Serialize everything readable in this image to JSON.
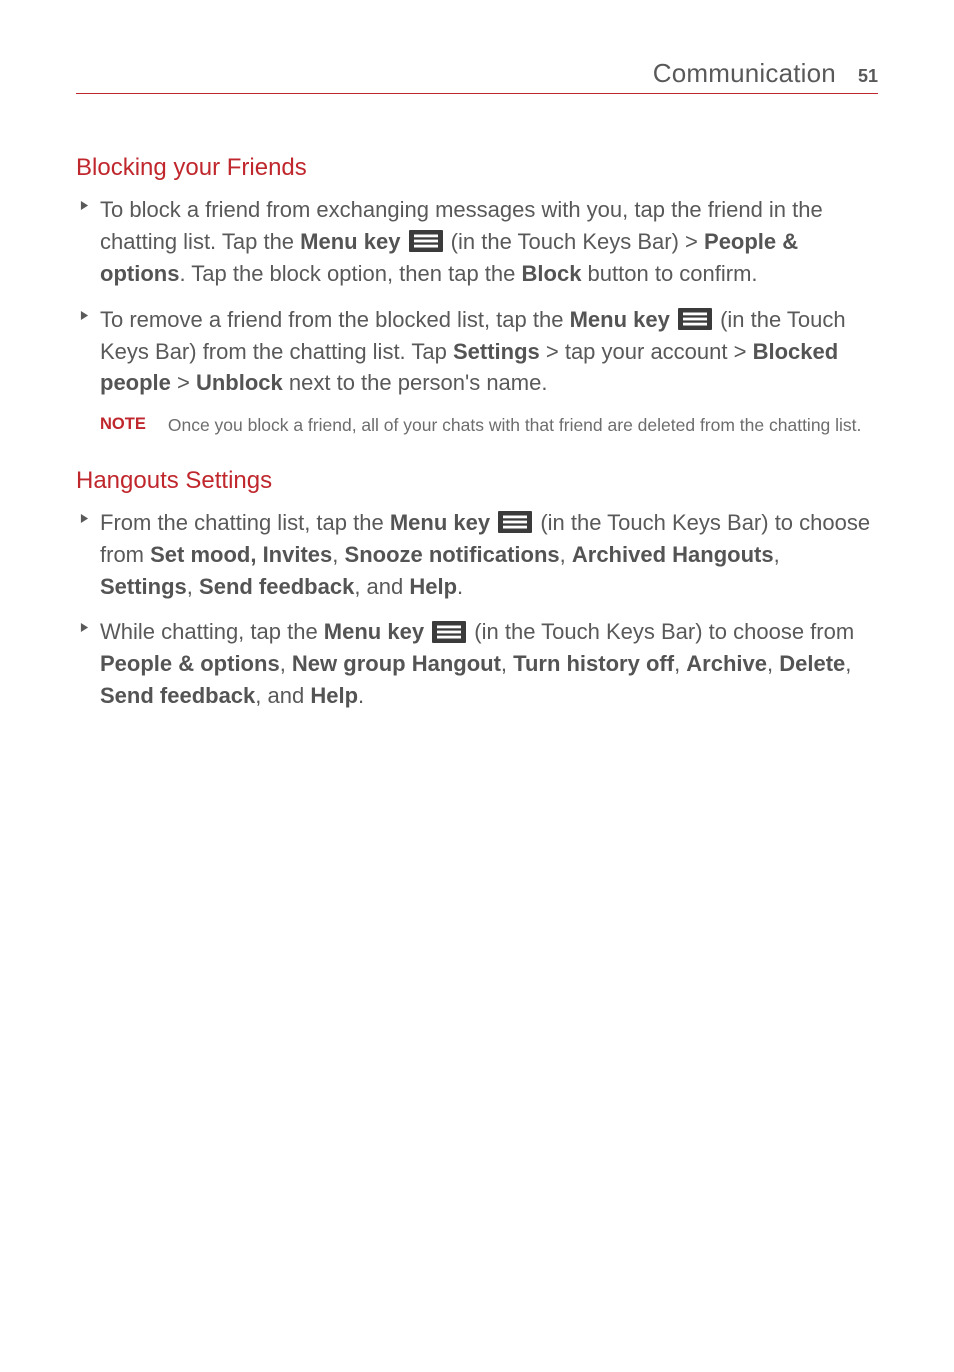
{
  "header": {
    "section": "Communication",
    "page_number": "51"
  },
  "section_a": {
    "heading": "Blocking your Friends",
    "bullet1": {
      "t1": "To block a friend from exchanging messages with you, tap the friend in the chatting list. Tap the ",
      "b1": "Menu key",
      "t2": " ",
      "menu_icon_name": "menu-key-icon",
      "t3": " (in the Touch Keys Bar) > ",
      "b2": "People & options",
      "t4": ". Tap the block option, then tap the ",
      "b3": "Block",
      "t5": " button to confirm."
    },
    "bullet2": {
      "t1": "To remove a friend from the blocked list, tap the ",
      "b1": "Menu key",
      "t2": " ",
      "menu_icon_name": "menu-key-icon",
      "t3": " (in the Touch Keys Bar) from the chatting list. Tap ",
      "b2": "Settings",
      "t4": " > tap your account > ",
      "b3": "Blocked people",
      "t5": " > ",
      "b4": "Unblock",
      "t6": " next to the person's name."
    },
    "note": {
      "label": "NOTE",
      "text": "Once you block a friend, all of your chats with that friend are deleted from the chatting list."
    }
  },
  "section_b": {
    "heading": "Hangouts Settings",
    "bullet1": {
      "t1": "From the chatting list, tap the ",
      "b1": "Menu key",
      "t2": " ",
      "menu_icon_name": "menu-key-icon",
      "t3": " (in the Touch Keys Bar) to choose from ",
      "b2": "Set mood, Invites",
      "t4": ", ",
      "b3": "Snooze notifications",
      "t5": ", ",
      "b4": "Archived Hangouts",
      "t6": ", ",
      "b5": "Settings",
      "t7": ", ",
      "b6": "Send feedback",
      "t8": ", and ",
      "b7": "Help",
      "t9": "."
    },
    "bullet2": {
      "t1": "While chatting, tap the ",
      "b1": "Menu key",
      "t2": " ",
      "menu_icon_name": "menu-key-icon",
      "t3": " (in the Touch Keys Bar) to choose from ",
      "b2": "People & options",
      "t4": ", ",
      "b3": "New group Hangout",
      "t5": ", ",
      "b4": "Turn history off",
      "t6": ", ",
      "b5": "Archive",
      "t7": ", ",
      "b6": "Delete",
      "t8": ", ",
      "b7": "Send feedback",
      "t9": ", and ",
      "b8": "Help",
      "t10": "."
    }
  }
}
